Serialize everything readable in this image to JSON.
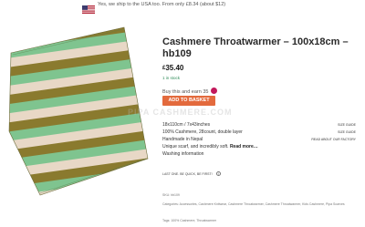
{
  "ship_banner": {
    "flag_icon": "us-flag-icon",
    "text": "Yes, we ship to the USA too. From only £8.34 (about $12)"
  },
  "product": {
    "title": "Cashmere Throatwarmer – 100x18cm – hb109",
    "currency": "£",
    "price": "35.40",
    "stock": "1 in stock",
    "earn_text": "Buy this and earn 35",
    "earn_icon": "points-badge-icon",
    "add_to_basket": "ADD TO BASKET",
    "specs": [
      "18x110cm / 7x43inches",
      "100% Cashmere, 28count, double layer",
      "Handmade in Nepal",
      "Unique scarf, and incredibly soft."
    ],
    "read_more": "Read more…",
    "washing": "Washing information",
    "side_links": [
      "SIZE GUIDE",
      "SIZE GUIDE",
      "READ ABOUT OUR FACTORY"
    ],
    "last_one": "LAST ONE. BE QUICK, BE FIRST!",
    "sku": "SKU: hb109",
    "categories": "Categories: Accessories, Cashmere Knitwear, Cashmere Throatwarmer, Cashmere Throatwarmer, Kids Cashmere, Pipa Scarves",
    "tags": "Tags: 100% Cashmere, Throatwarmer"
  },
  "watermark": "PIPA CASHMERE.COM",
  "colors": {
    "button": "#e36a3d",
    "stock": "#2e8b57",
    "stripe_green": "#7fc48f",
    "stripe_olive": "#8a7a2e",
    "stripe_cream": "#e8d8c6"
  }
}
